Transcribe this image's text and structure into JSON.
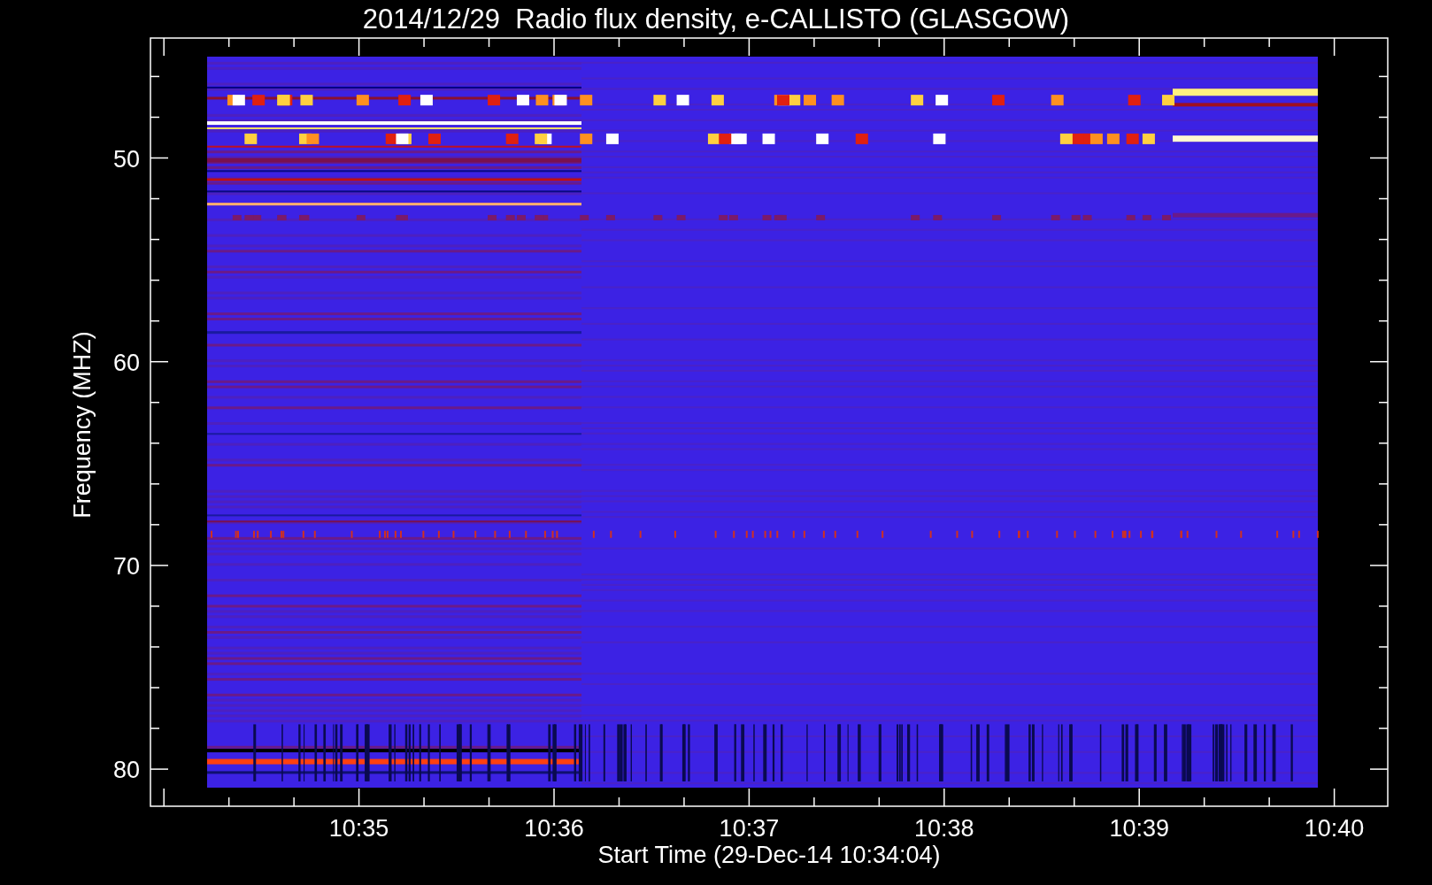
{
  "title": "2014/12/29  Radio flux density, e-CALLISTO (GLASGOW)",
  "y_axis": {
    "label": "Frequency (MHZ)",
    "ticks": [
      "50",
      "60",
      "70",
      "80"
    ]
  },
  "x_axis": {
    "label": "Start Time (29-Dec-14 10:34:04)",
    "ticks": [
      "10:35",
      "10:36",
      "10:37",
      "10:38",
      "10:39",
      "10:40"
    ]
  }
}
